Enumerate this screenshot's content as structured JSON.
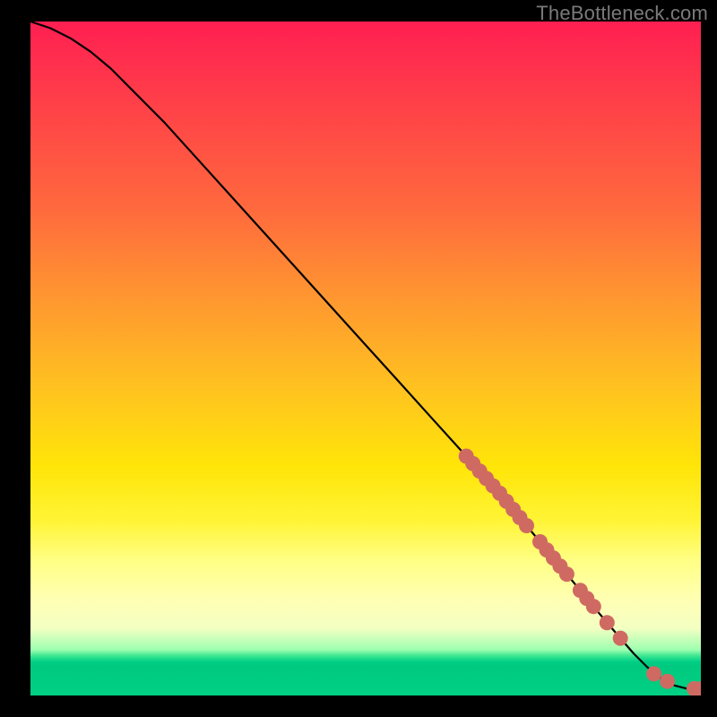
{
  "watermark": "TheBottleneck.com",
  "chart_data": {
    "type": "line",
    "title": "",
    "xlabel": "",
    "ylabel": "",
    "xlim": [
      0,
      100
    ],
    "ylim": [
      0,
      100
    ],
    "grid": false,
    "series": [
      {
        "name": "bottleneck-curve",
        "x": [
          0,
          3,
          6,
          9,
          12,
          15,
          20,
          25,
          30,
          35,
          40,
          45,
          50,
          55,
          60,
          65,
          70,
          75,
          80,
          85,
          88,
          90,
          92,
          94,
          96,
          98,
          100
        ],
        "y": [
          100,
          99,
          97.5,
          95.5,
          93,
          90,
          85,
          79.5,
          74,
          68.5,
          63,
          57.5,
          52,
          46.5,
          41,
          35.5,
          30,
          24,
          18,
          12,
          8.5,
          6.2,
          4.2,
          2.6,
          1.5,
          1.0,
          1.0
        ]
      }
    ],
    "marker_points": {
      "name": "highlighted-range",
      "color": "#cf6a62",
      "x": [
        65,
        66,
        67,
        68,
        69,
        70,
        71,
        72,
        73,
        74,
        76,
        77,
        78,
        79,
        80,
        82,
        83,
        84,
        86,
        88,
        93,
        95,
        99,
        100
      ],
      "y": [
        35.5,
        34.4,
        33.3,
        32.2,
        31.1,
        30,
        28.8,
        27.6,
        26.4,
        25.2,
        22.8,
        21.6,
        20.4,
        19.2,
        18,
        15.6,
        14.4,
        13.2,
        10.8,
        8.5,
        3.2,
        2.1,
        1.0,
        1.0
      ]
    },
    "legend": false
  }
}
